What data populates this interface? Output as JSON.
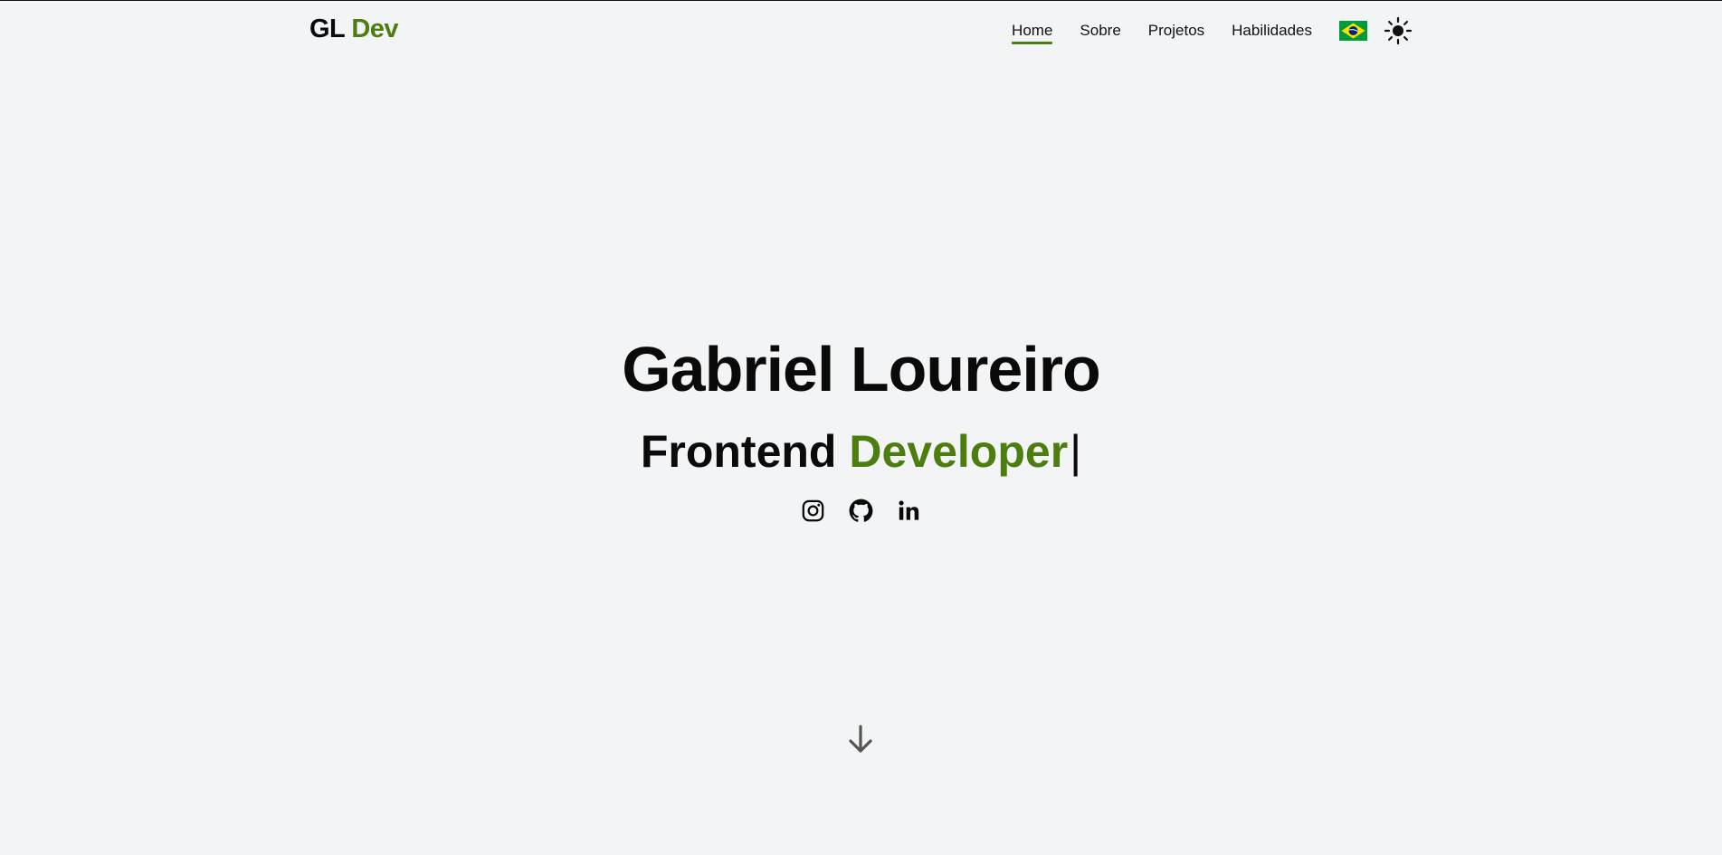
{
  "header": {
    "logo_primary": "GL",
    "logo_accent": "Dev",
    "nav": [
      {
        "label": "Home",
        "active": true
      },
      {
        "label": "Sobre",
        "active": false
      },
      {
        "label": "Projetos",
        "active": false
      },
      {
        "label": "Habilidades",
        "active": false
      }
    ],
    "language_flag_icon": "brazil-flag-icon",
    "theme_toggle_icon": "sun-icon"
  },
  "hero": {
    "name": "Gabriel Loureiro",
    "role_primary": "Frontend",
    "role_accent": "Developer",
    "typing_cursor": "|",
    "socials": [
      {
        "icon": "instagram-icon"
      },
      {
        "icon": "github-icon"
      },
      {
        "icon": "linkedin-icon"
      }
    ],
    "scroll_icon": "arrow-down-icon"
  },
  "colors": {
    "background": "#f3f4f6",
    "accent": "#4d7c0f",
    "text": "#0a0a0a",
    "scroll_arrow": "#555555"
  }
}
